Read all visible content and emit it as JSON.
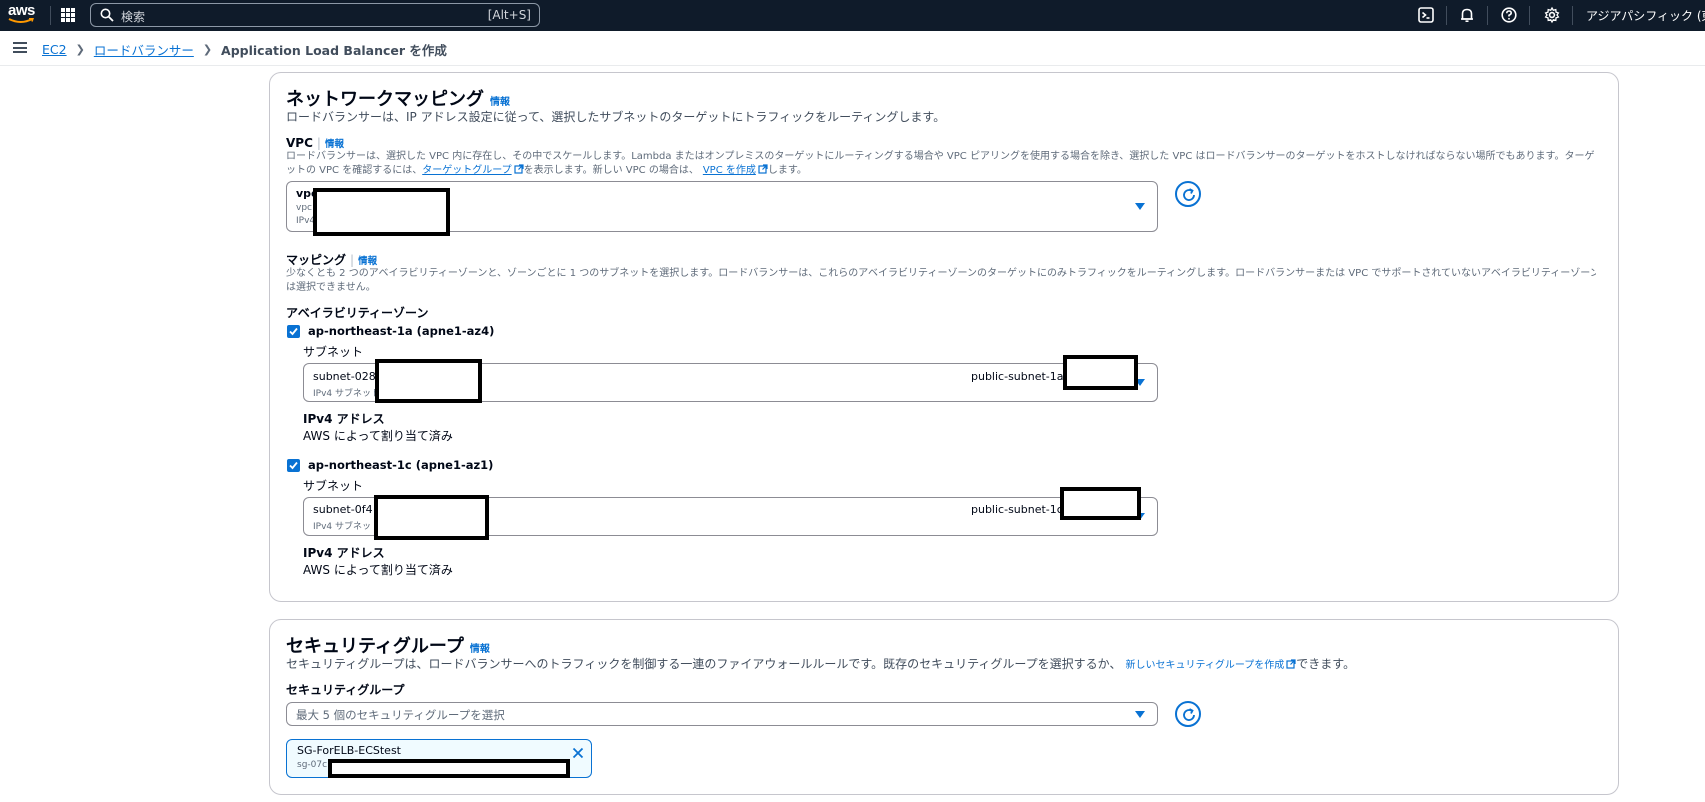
{
  "nav": {
    "logo": "aws",
    "search_placeholder": "検索",
    "search_shortcut": "[Alt+S]",
    "region": "アジアパシフィック (東京)"
  },
  "breadcrumb": {
    "items": [
      "EC2",
      "ロードバランサー"
    ],
    "current": "Application Load Balancer を作成"
  },
  "network": {
    "title": "ネットワークマッピング",
    "info": "情報",
    "description": "ロードバランサーは、IP アドレス設定に従って、選択したサブネットのターゲットにトラフィックをルーティングします。",
    "vpc": {
      "label": "VPC",
      "info": "情報",
      "help_line1": "ロードバランサーは、選択した VPC 内に存在し、その中でスケールします。Lambda またはオンプレミスのターゲットにルーティングする場合や VPC ピアリングを使用する場合を除き、選択した VPC はロードバランサーのターゲットをホストしなければならない場所でもあります。ターゲ",
      "help_line2_pre": "ットの VPC を確認するには、",
      "target_group_link": "ターゲットグループ",
      "help_line2_mid": "を表示します。新しい VPC の場合は、",
      "create_vpc_link": "VPC を作成",
      "help_line2_post": "します。",
      "value_main": "vpc",
      "value_sub1": "vpc",
      "value_sub2": "IPv4"
    },
    "mapping": {
      "label": "マッピング",
      "info": "情報",
      "help_line1": "少なくとも 2 つのアベイラビリティーゾーンと、ゾーンごとに 1 つのサブネットを選択します。ロードバランサーは、これらのアベイラビリティーゾーンのターゲットにのみトラフィックをルーティングします。ロードバランサーまたは VPC でサポートされていないアベイラビリティーゾーン",
      "help_line2": "は選択できません。",
      "az_heading": "アベイラビリティーゾーン",
      "zones": [
        {
          "name": "ap-northeast-1a (apne1-az4)",
          "subnet_label": "サブネット",
          "subnet_id": "subnet-028",
          "subnet_sub": "IPv4 サブネット",
          "subnet_name": "public-subnet-1a-",
          "ipv4_label": "IPv4 アドレス",
          "ipv4_value": "AWS によって割り当て済み"
        },
        {
          "name": "ap-northeast-1c (apne1-az1)",
          "subnet_label": "サブネット",
          "subnet_id": "subnet-0f4",
          "subnet_sub": "IPv4 サブネット",
          "subnet_name": "public-subnet-1c",
          "ipv4_label": "IPv4 アドレス",
          "ipv4_value": "AWS によって割り当て済み"
        }
      ]
    }
  },
  "security": {
    "title": "セキュリティグループ",
    "info": "情報",
    "description_pre": "セキュリティグループは、ロードバランサーへのトラフィックを制御する一連のファイアウォールルールです。既存のセキュリティグループを選択するか、",
    "create_link": "新しいセキュリティグループを作成",
    "description_post": "できます。",
    "field_label": "セキュリティグループ",
    "placeholder": "最大 5 個のセキュリティグループを選択",
    "token_name": "SG-ForELB-ECStest",
    "token_id": "sg-07c"
  },
  "colors": {
    "nav_bg": "#0f1b2a",
    "link": "#0972d3",
    "border": "#c6c6cd"
  }
}
